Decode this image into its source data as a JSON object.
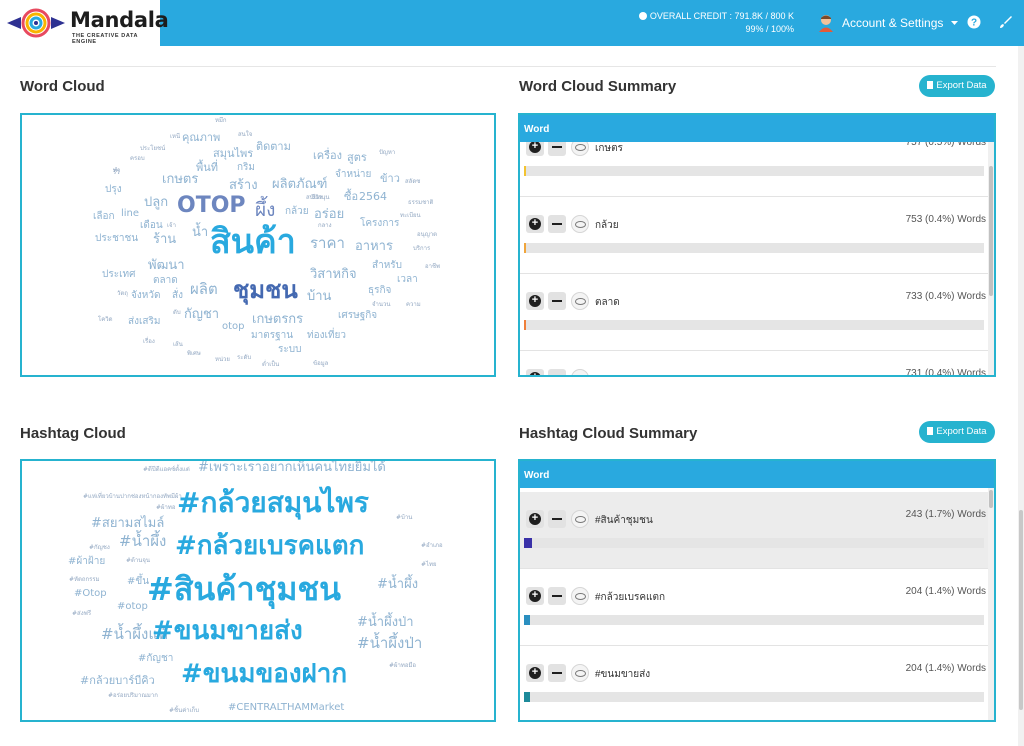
{
  "header": {
    "brand": "Mandala",
    "tagline": "THE CREATIVE DATA ENGINE",
    "credit_line1": "OVERALL CREDIT : 791.8K / 800 K",
    "credit_line2": "99% / 100%",
    "account_label": "Account & Settings",
    "icons": [
      "logo-icon",
      "avatar-icon",
      "chevron-down-icon",
      "help-icon",
      "brush-icon"
    ],
    "accent_color": "#29a9df"
  },
  "word_cloud": {
    "title": "Word Cloud",
    "words": [
      {
        "t": "หมึก",
        "s": 6,
        "c": "#93a8c2"
      },
      {
        "t": "เหนี",
        "s": 6,
        "c": "#93a8c2"
      },
      {
        "t": "คุณภาพ",
        "s": 11,
        "c": "#8fb3d1"
      },
      {
        "t": "สนใจ",
        "s": 6,
        "c": "#93a8c2"
      },
      {
        "t": "ประโยชน์",
        "s": 6,
        "c": "#93a8c2"
      },
      {
        "t": "สมุนไพร",
        "s": 11,
        "c": "#8fb3d1"
      },
      {
        "t": "ติดตาม",
        "s": 11,
        "c": "#8fb3d1"
      },
      {
        "t": "ครอบ",
        "s": 6,
        "c": "#93a8c2"
      },
      {
        "t": "พื้นที่",
        "s": 11,
        "c": "#8fb3d1"
      },
      {
        "t": "เครื่อง",
        "s": 11,
        "c": "#8fb3d1"
      },
      {
        "t": "สูตร",
        "s": 11,
        "c": "#8fb3d1"
      },
      {
        "t": "ปัญหา",
        "s": 6,
        "c": "#93a8c2"
      },
      {
        "t": "ทำ",
        "s": 6,
        "c": "#93a8c2"
      },
      {
        "t": "รีวิ",
        "s": 6,
        "c": "#93a8c2"
      },
      {
        "t": "กริม",
        "s": 10,
        "c": "#8fb3d1"
      },
      {
        "t": "จำหน่าย",
        "s": 10,
        "c": "#8fb3d1"
      },
      {
        "t": "ข้าว",
        "s": 11,
        "c": "#8fb3d1"
      },
      {
        "t": "เกษตร",
        "s": 13,
        "c": "#8fb3d1"
      },
      {
        "t": "สร้าง",
        "s": 13,
        "c": "#8fb3d1"
      },
      {
        "t": "ผลิตภัณฑ์",
        "s": 13,
        "c": "#8fb3d1"
      },
      {
        "t": "ปรุง",
        "s": 10,
        "c": "#8fb3d1"
      },
      {
        "t": "สลัดซ",
        "s": 6,
        "c": "#93a8c2"
      },
      {
        "t": "ปลูก",
        "s": 13,
        "c": "#8fb3d1"
      },
      {
        "t": "OTOP",
        "s": 22,
        "c": "#6d86bf"
      },
      {
        "t": "ผึ้ง",
        "s": 19,
        "c": "#6d86bf"
      },
      {
        "t": "ซื้อ",
        "s": 11,
        "c": "#8fb3d1"
      },
      {
        "t": "2564",
        "s": 11,
        "c": "#8fb3d1"
      },
      {
        "t": "รีวิว",
        "s": 6,
        "c": "#93a8c2"
      },
      {
        "t": "เลือก",
        "s": 10,
        "c": "#8fb3d1"
      },
      {
        "t": "line",
        "s": 10,
        "c": "#8fb3d1"
      },
      {
        "t": "กล้วย",
        "s": 10,
        "c": "#8fb3d1"
      },
      {
        "t": "อร่อย",
        "s": 13,
        "c": "#8fb3d1"
      },
      {
        "t": "สนับสนุน",
        "s": 6,
        "c": "#93a8c2"
      },
      {
        "t": "ธรรมชาติ",
        "s": 6,
        "c": "#93a8c2"
      },
      {
        "t": "เดือน",
        "s": 10,
        "c": "#8fb3d1"
      },
      {
        "t": "เจ้า",
        "s": 6,
        "c": "#93a8c2"
      },
      {
        "t": "กลาง",
        "s": 6,
        "c": "#93a8c2"
      },
      {
        "t": "โครงการ",
        "s": 10,
        "c": "#8fb3d1"
      },
      {
        "t": "ทะเบียน",
        "s": 6,
        "c": "#93a8c2"
      },
      {
        "t": "ประชาชน",
        "s": 10,
        "c": "#8fb3d1"
      },
      {
        "t": "ร้าน",
        "s": 13,
        "c": "#8fb3d1"
      },
      {
        "t": "น้ำ",
        "s": 13,
        "c": "#8fb3d1"
      },
      {
        "t": "สินค้า",
        "s": 34,
        "c": "#29a9df"
      },
      {
        "t": "ราคา",
        "s": 15,
        "c": "#8fb3d1"
      },
      {
        "t": "อาหาร",
        "s": 13,
        "c": "#8fb3d1"
      },
      {
        "t": "อนุญาต",
        "s": 6,
        "c": "#93a8c2"
      },
      {
        "t": "บริการ",
        "s": 6,
        "c": "#93a8c2"
      },
      {
        "t": "พัฒนา",
        "s": 13,
        "c": "#8fb3d1"
      },
      {
        "t": "สำหรับ",
        "s": 10,
        "c": "#8fb3d1"
      },
      {
        "t": "อาชีพ",
        "s": 6,
        "c": "#93a8c2"
      },
      {
        "t": "ประเทศ",
        "s": 10,
        "c": "#8fb3d1"
      },
      {
        "t": "ตลาด",
        "s": 10,
        "c": "#8fb3d1"
      },
      {
        "t": "ชุมชน",
        "s": 24,
        "c": "#4469b1"
      },
      {
        "t": "วิสาหกิจ",
        "s": 13,
        "c": "#8fb3d1"
      },
      {
        "t": "เวลา",
        "s": 10,
        "c": "#8fb3d1"
      },
      {
        "t": "วัตถุ",
        "s": 6,
        "c": "#93a8c2"
      },
      {
        "t": "จังหวัด",
        "s": 10,
        "c": "#8fb3d1"
      },
      {
        "t": "สั่ง",
        "s": 10,
        "c": "#8fb3d1"
      },
      {
        "t": "ผลิต",
        "s": 15,
        "c": "#8fb3d1"
      },
      {
        "t": "บ้าน",
        "s": 13,
        "c": "#8fb3d1"
      },
      {
        "t": "ธุรกิจ",
        "s": 10,
        "c": "#8fb3d1"
      },
      {
        "t": "จำนวน",
        "s": 6,
        "c": "#93a8c2"
      },
      {
        "t": "ความ",
        "s": 6,
        "c": "#93a8c2"
      },
      {
        "t": "ดับ",
        "s": 6,
        "c": "#93a8c2"
      },
      {
        "t": "กัญชา",
        "s": 13,
        "c": "#8fb3d1"
      },
      {
        "t": "โควิด",
        "s": 6,
        "c": "#93a8c2"
      },
      {
        "t": "ส่งเสริม",
        "s": 10,
        "c": "#8fb3d1"
      },
      {
        "t": "otop",
        "s": 10,
        "c": "#8fb3d1"
      },
      {
        "t": "เกษตรกร",
        "s": 13,
        "c": "#8fb3d1"
      },
      {
        "t": "เศรษฐกิจ",
        "s": 10,
        "c": "#8fb3d1"
      },
      {
        "t": "มาตรฐาน",
        "s": 10,
        "c": "#8fb3d1"
      },
      {
        "t": "ท่องเที่ยว",
        "s": 10,
        "c": "#8fb3d1"
      },
      {
        "t": "เรื่อง",
        "s": 6,
        "c": "#93a8c2"
      },
      {
        "t": "เส้น",
        "s": 6,
        "c": "#93a8c2"
      },
      {
        "t": "ระบบ",
        "s": 10,
        "c": "#8fb3d1"
      },
      {
        "t": "พิเศษ",
        "s": 6,
        "c": "#93a8c2"
      },
      {
        "t": "หน่วย",
        "s": 6,
        "c": "#93a8c2"
      },
      {
        "t": "ระดับ",
        "s": 6,
        "c": "#93a8c2"
      },
      {
        "t": "ต่ำเป็น",
        "s": 6,
        "c": "#93a8c2"
      },
      {
        "t": "ข้อมูล",
        "s": 6,
        "c": "#93a8c2"
      }
    ]
  },
  "word_summary": {
    "title": "Word Cloud Summary",
    "export_label": "Export Data",
    "column": "Word",
    "rows": [
      {
        "label": "เกษตร",
        "count": "757 (0.5%) Words",
        "fill": 0.004,
        "color": "#f3c331"
      },
      {
        "label": "กล้วย",
        "count": "753 (0.4%) Words",
        "fill": 0.004,
        "color": "#f0a53c"
      },
      {
        "label": "ตลาด",
        "count": "733 (0.4%) Words",
        "fill": 0.004,
        "color": "#ef7f3a"
      },
      {
        "label": "",
        "count": "731 (0.4%) Words",
        "fill": 0.004,
        "color": "#e86a3a"
      }
    ]
  },
  "hashtag_cloud": {
    "title": "Hashtag Cloud",
    "words": [
      {
        "t": "#ดีปีดีแอคซ์ตั้งแต่",
        "s": 6,
        "c": "#93a8c2"
      },
      {
        "t": "#เพราะเราอยากเห็นคนไทยยิ้มได้",
        "s": 13,
        "c": "#8fb3d1"
      },
      {
        "t": "#แห่เที่ยวบ้านปากช่องหน้ากองทัพมีผ้า",
        "s": 6,
        "c": "#93a8c2"
      },
      {
        "t": "#ผ้าทอ",
        "s": 6,
        "c": "#93a8c2"
      },
      {
        "t": "#กล้วยสมุนไพร",
        "s": 28,
        "c": "#29a9df"
      },
      {
        "t": "#สยามสไมล์",
        "s": 13,
        "c": "#8fb3d1"
      },
      {
        "t": "#บ้าน",
        "s": 6,
        "c": "#93a8c2"
      },
      {
        "t": "#น้ำผึ้ง",
        "s": 15,
        "c": "#8fb3d1"
      },
      {
        "t": "#กล้วยเบรคแตก",
        "s": 26,
        "c": "#29a9df"
      },
      {
        "t": "#กัญชง",
        "s": 6,
        "c": "#93a8c2"
      },
      {
        "t": "#ผ้าฝ้าย",
        "s": 10,
        "c": "#8fb3d1"
      },
      {
        "t": "#อำเภอ",
        "s": 6,
        "c": "#93a8c2"
      },
      {
        "t": "#ต้านจุน",
        "s": 6,
        "c": "#93a8c2"
      },
      {
        "t": "#ไทย",
        "s": 6,
        "c": "#93a8c2"
      },
      {
        "t": "#หัตถกรรม",
        "s": 6,
        "c": "#93a8c2"
      },
      {
        "t": "#ขึ้น",
        "s": 10,
        "c": "#8fb3d1"
      },
      {
        "t": "#สินค้าชุมชน",
        "s": 32,
        "c": "#29a9df"
      },
      {
        "t": "#น้ำผึ้ง",
        "s": 13,
        "c": "#8fb3d1"
      },
      {
        "t": "#Otop",
        "s": 10,
        "c": "#8fb3d1"
      },
      {
        "t": "#otop",
        "s": 10,
        "c": "#8fb3d1"
      },
      {
        "t": "#ส่งฟรี",
        "s": 6,
        "c": "#93a8c2"
      },
      {
        "t": "#น้ำผึ้งป่า",
        "s": 13,
        "c": "#8fb3d1"
      },
      {
        "t": "#น้ำผึ้งแท้",
        "s": 15,
        "c": "#8fb3d1"
      },
      {
        "t": "#ขนมขายส่ง",
        "s": 26,
        "c": "#29a9df"
      },
      {
        "t": "#น้ำผึ้งป่า",
        "s": 15,
        "c": "#8fb3d1"
      },
      {
        "t": "#กัญชา",
        "s": 10,
        "c": "#8fb3d1"
      },
      {
        "t": "#ผ้าทอมือ",
        "s": 6,
        "c": "#93a8c2"
      },
      {
        "t": "#กล้วยบาร์บีคิว",
        "s": 11,
        "c": "#8fb3d1"
      },
      {
        "t": "#ขนมของฝาก",
        "s": 26,
        "c": "#29a9df"
      },
      {
        "t": "#อร่อยปริมาณมาก",
        "s": 6,
        "c": "#93a8c2"
      },
      {
        "t": "#ชิ้นค่าเก็บ",
        "s": 6,
        "c": "#93a8c2"
      },
      {
        "t": "#CENTRALTHAMMarket",
        "s": 10,
        "c": "#8fb3d1"
      }
    ]
  },
  "hashtag_summary": {
    "title": "Hashtag Cloud Summary",
    "export_label": "Export Data",
    "column": "Word",
    "rows": [
      {
        "label": "#สินค้าชุมชน",
        "count": "243 (1.7%) Words",
        "fill": 0.017,
        "color": "#3a31a8"
      },
      {
        "label": "#กล้วยเบรคแตก",
        "count": "204 (1.4%) Words",
        "fill": 0.014,
        "color": "#2a8fc0"
      },
      {
        "label": "#ขนมขายส่ง",
        "count": "204 (1.4%) Words",
        "fill": 0.014,
        "color": "#1d8a9a"
      }
    ]
  }
}
